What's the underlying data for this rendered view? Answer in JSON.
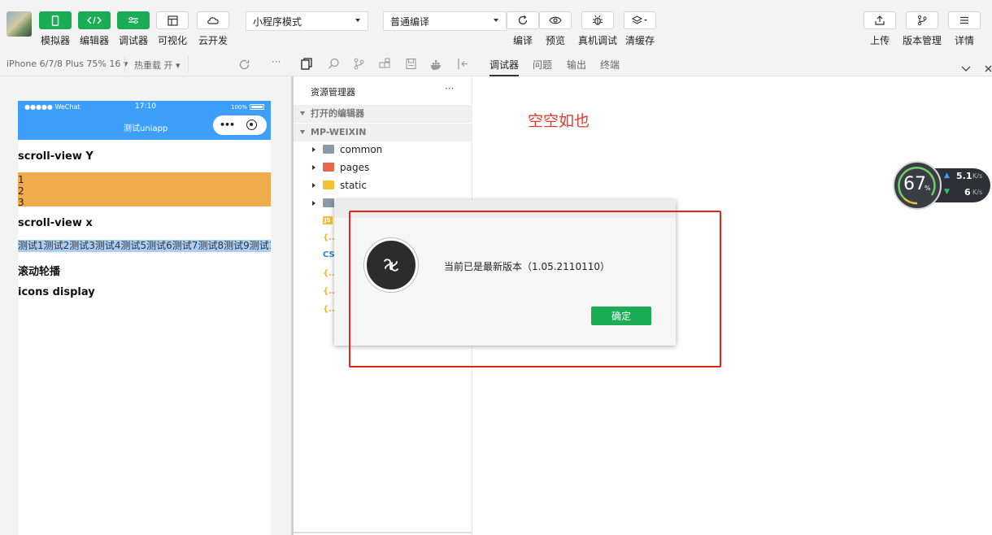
{
  "toolbar": {
    "left_buttons": [
      {
        "label": "模拟器",
        "icon": "phone-icon"
      },
      {
        "label": "编辑器",
        "icon": "code-icon"
      },
      {
        "label": "调试器",
        "icon": "sliders-icon"
      },
      {
        "label": "可视化",
        "icon": "layout-icon"
      },
      {
        "label": "云开发",
        "icon": "cloud-icon"
      }
    ],
    "mode_select": "小程序模式",
    "compile_select": "普通编译",
    "mid_buttons": [
      {
        "label": "编译",
        "icon": "refresh-icon"
      },
      {
        "label": "预览",
        "icon": "eye-icon"
      },
      {
        "label": "真机调试",
        "icon": "bug-icon"
      },
      {
        "label": "清缓存",
        "icon": "layers-icon"
      }
    ],
    "right_buttons": [
      {
        "label": "上传",
        "icon": "upload-icon"
      },
      {
        "label": "版本管理",
        "icon": "branch-icon"
      },
      {
        "label": "详情",
        "icon": "menu-icon"
      }
    ]
  },
  "subbar": {
    "device": "iPhone 6/7/8 Plus 75% 16",
    "hot_reload": "热重载 开",
    "devtool_tabs": [
      "调试器",
      "问题",
      "输出",
      "终端"
    ],
    "active_tab": "调试器"
  },
  "simulator": {
    "status_carrier": "●●●●● WeChat",
    "status_time": "17:10",
    "status_battery": "100%",
    "nav_title": "测试uniapp",
    "scroll_y_title": "scroll-view Y",
    "scroll_y_items": [
      "1",
      "2",
      "3"
    ],
    "scroll_x_title": "scroll-view x",
    "scroll_x_text": "测试1测试2测试3测试4测试5测试6测试7测试8测试9测试1",
    "swiper_title": "滚动轮播",
    "icons_title": "icons display"
  },
  "explorer": {
    "title": "资源管理器",
    "more": "···",
    "open_editors": "打开的编辑器",
    "project": "MP-WEIXIN",
    "folders": [
      "common",
      "pages",
      "static"
    ],
    "file_icons": [
      "JS",
      "{..}",
      "CSS",
      "{..}",
      "{..}",
      "{..}"
    ]
  },
  "editor": {
    "empty_text": "空空如也"
  },
  "speed": {
    "percent": "67",
    "percent_unit": "%",
    "up": "5.1",
    "down": "6",
    "unit": "K/s"
  },
  "dialog": {
    "message": "当前已是最新版本（1.05.2110110）",
    "ok_label": "确定"
  },
  "colors": {
    "green": "#1aad55",
    "nav_blue": "#3e9ffb",
    "scroll_y_bg": "#f0ac4c",
    "scroll_x_bg": "#a9cff5",
    "highlight_red": "#e8241a"
  }
}
